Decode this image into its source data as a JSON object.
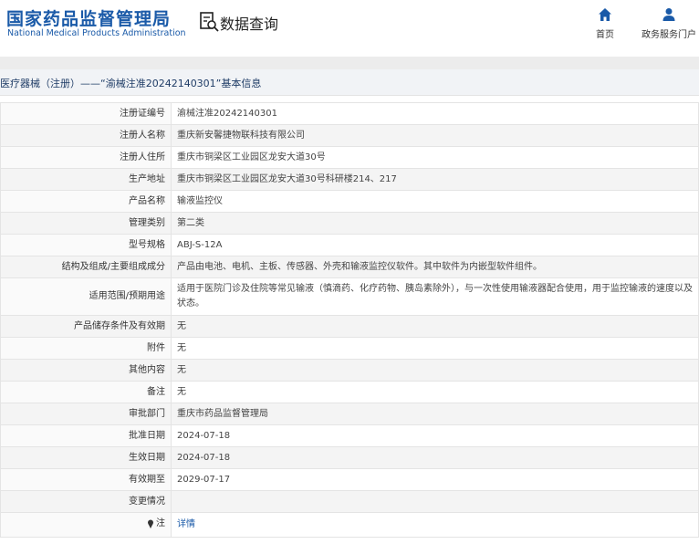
{
  "header": {
    "logo_cn": "国家药品监督管理局",
    "logo_en": "National Medical Products Administration",
    "query_label": "数据查询",
    "nav": [
      {
        "label": "首页",
        "icon": "home-icon"
      },
      {
        "label": "政务服务门户",
        "icon": "user-icon"
      }
    ]
  },
  "breadcrumb": "医疗器械（注册）——“渝械注准20242140301”基本信息",
  "rows": [
    {
      "key": "注册证编号",
      "value": "渝械注准20242140301"
    },
    {
      "key": "注册人名称",
      "value": "重庆新安馨捷物联科技有限公司"
    },
    {
      "key": "注册人住所",
      "value": "重庆市铜梁区工业园区龙安大道30号"
    },
    {
      "key": "生产地址",
      "value": "重庆市铜梁区工业园区龙安大道30号科研楼214、217"
    },
    {
      "key": "产品名称",
      "value": "输液监控仪"
    },
    {
      "key": "管理类别",
      "value": "第二类"
    },
    {
      "key": "型号规格",
      "value": "ABJ-S-12A"
    },
    {
      "key": "结构及组成/主要组成成分",
      "value": "产品由电池、电机、主板、传感器、外壳和输液监控仪软件。其中软件为内嵌型软件组件。"
    },
    {
      "key": "适用范围/预期用途",
      "value": "适用于医院门诊及住院等常见输液（慎滴药、化疗药物、胰岛素除外），与一次性使用输液器配合使用，用于监控输液的速度以及状态。"
    },
    {
      "key": "产品储存条件及有效期",
      "value": "无"
    },
    {
      "key": "附件",
      "value": "无"
    },
    {
      "key": "其他内容",
      "value": "无"
    },
    {
      "key": "备注",
      "value": "无"
    },
    {
      "key": "审批部门",
      "value": "重庆市药品监督管理局"
    },
    {
      "key": "批准日期",
      "value": "2024-07-18"
    },
    {
      "key": "生效日期",
      "value": "2024-07-18"
    },
    {
      "key": "有效期至",
      "value": "2029-07-17"
    },
    {
      "key": "变更情况",
      "value": ""
    },
    {
      "key": "注",
      "value": "详情"
    }
  ]
}
